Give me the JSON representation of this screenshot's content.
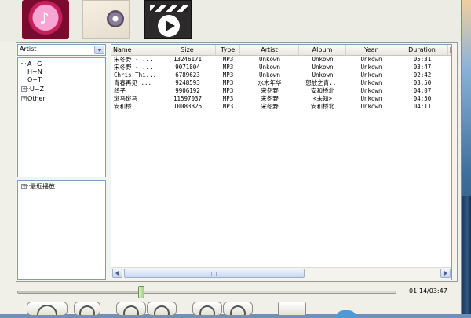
{
  "toolbar": {
    "buttons": [
      {
        "name": "artist-view",
        "icon": "artist-music-icon"
      },
      {
        "name": "album-view",
        "icon": "album-disc-icon"
      },
      {
        "name": "video-view",
        "icon": "video-clapper-icon"
      }
    ]
  },
  "browser": {
    "group_by": "Artist",
    "tree": [
      "A~G",
      "H~N",
      "O~T",
      "U~Z",
      "Other"
    ],
    "playlist_tree": [
      "最近播放"
    ]
  },
  "track_list": {
    "columns": [
      "Name",
      "Size",
      "Type",
      "Artist",
      "Album",
      "Year",
      "Duration"
    ],
    "rows": [
      [
        "宋冬野 - ...",
        "13246171",
        "MP3",
        "Unkown",
        "Unkown",
        "Unkown",
        "05:31"
      ],
      [
        "宋冬野 - ...",
        "9071804",
        "MP3",
        "Unkown",
        "Unkown",
        "Unkown",
        "03:47"
      ],
      [
        "Chris Thi...",
        "6789623",
        "MP3",
        "Unkown",
        "Unkown",
        "Unkown",
        "02:42"
      ],
      [
        "青春再见 ...",
        "9248593",
        "MP3",
        "水木年华",
        "怒放之青...",
        "Unkown",
        "03:50"
      ],
      [
        "鸽子",
        "9906192",
        "MP3",
        "宋冬野",
        "安和桥北",
        "Unkown",
        "04:07"
      ],
      [
        "斑马斑马",
        "11597037",
        "MP3",
        "宋冬野",
        "<未知>",
        "Unkown",
        "04:50"
      ],
      [
        "安和桥",
        "10083826",
        "MP3",
        "宋冬野",
        "安和桥北",
        "Unkown",
        "04:11"
      ]
    ]
  },
  "player": {
    "time": "01:14/03:47",
    "progress": 0.326
  },
  "colors": {
    "desktop": "#6f90b9",
    "window": "#f0efe8",
    "border": "#7f9db9"
  }
}
